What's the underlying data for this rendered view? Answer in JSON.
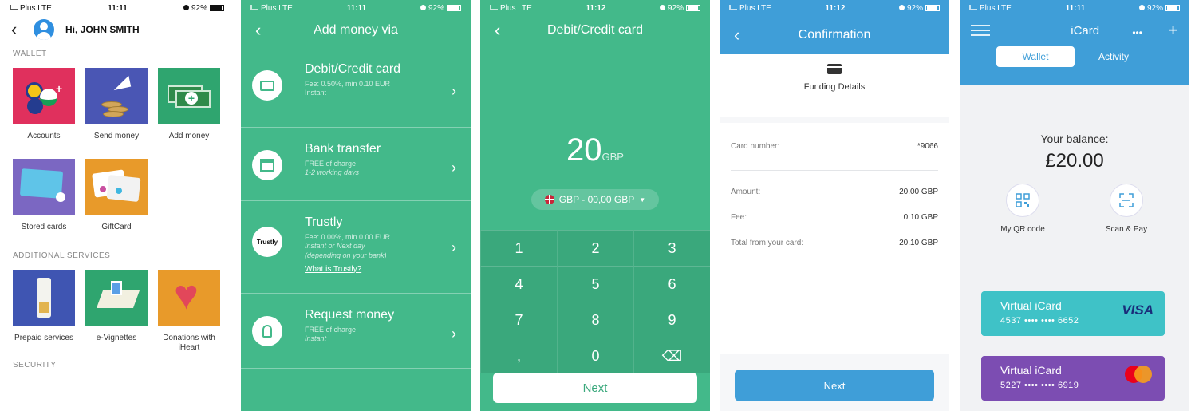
{
  "status": {
    "carrier": "Plus LTE",
    "battery": "92%",
    "time1": "11:11",
    "time2": "11:11",
    "time3": "11:12",
    "time4": "11:12",
    "time5": "11:11"
  },
  "screen1": {
    "greeting": "Hi, JOHN SMITH",
    "wallet_section": "WALLET",
    "wallet_tiles": [
      {
        "label": "Accounts",
        "color": "#e0305d"
      },
      {
        "label": "Send money",
        "color": "#4a56b4"
      },
      {
        "label": "Add money",
        "color": "#2fa56f"
      },
      {
        "label": "Stored cards",
        "color": "#7b67c2"
      },
      {
        "label": "GiftCard",
        "color": "#e89a2a"
      }
    ],
    "additional_section": "ADDITIONAL SERVICES",
    "additional_tiles": [
      {
        "label": "Prepaid services",
        "color": "#3f55b2"
      },
      {
        "label": "e-Vignettes",
        "color": "#2fa56f"
      },
      {
        "label": "Donations with iHeart",
        "color": "#e89a2a"
      }
    ],
    "security_section": "SECURITY"
  },
  "screen2": {
    "title": "Add money via",
    "options": [
      {
        "title": "Debit/Credit card",
        "line1": "Fee: 0.50%, min 0.10 EUR",
        "line2": "Instant",
        "line3": ""
      },
      {
        "title": "Bank transfer",
        "line1": "FREE of charge",
        "line2": "1-2 working days",
        "line3": ""
      },
      {
        "title": "Trustly",
        "line1": "Fee: 0.00%, min 0.00 EUR",
        "line2": "Instant or Next day",
        "line3": "(depending on your bank)",
        "link": "What is Trustly?",
        "logo_text": "Trustly"
      },
      {
        "title": "Request money",
        "line1": "FREE of charge",
        "line2": "Instant",
        "line3": ""
      }
    ]
  },
  "screen3": {
    "title": "Debit/Credit card",
    "amount": "20",
    "currency": "GBP",
    "account_selector": "GBP - 00,00 GBP",
    "keys": [
      "1",
      "2",
      "3",
      "4",
      "5",
      "6",
      "7",
      "8",
      "9",
      ",",
      "0",
      "⌫"
    ],
    "next_label": "Next"
  },
  "screen4": {
    "title": "Confirmation",
    "funding_title": "Funding Details",
    "card_number_label": "Card number:",
    "card_number_value": "*9066",
    "rows": [
      {
        "label": "Amount:",
        "value": "20.00 GBP"
      },
      {
        "label": "Fee:",
        "value": "0.10 GBP"
      },
      {
        "label": "Total from your card:",
        "value": "20.10 GBP"
      }
    ],
    "next_label": "Next"
  },
  "screen5": {
    "title": "iCard",
    "more": "•••",
    "plus": "+",
    "tab_wallet": "Wallet",
    "tab_activity": "Activity",
    "balance_label": "Your balance:",
    "balance_value": "£20.00",
    "qr_label": "My QR code",
    "scan_label": "Scan & Pay",
    "cards": [
      {
        "name": "Virtual iCard",
        "number": "4537 •••• •••• 6652",
        "brand": "VISA",
        "color": "#3fc2c7"
      },
      {
        "name": "Virtual iCard",
        "number": "5227 •••• •••• 6919",
        "brand": "Mastercard",
        "color": "#7c4db2"
      }
    ]
  }
}
